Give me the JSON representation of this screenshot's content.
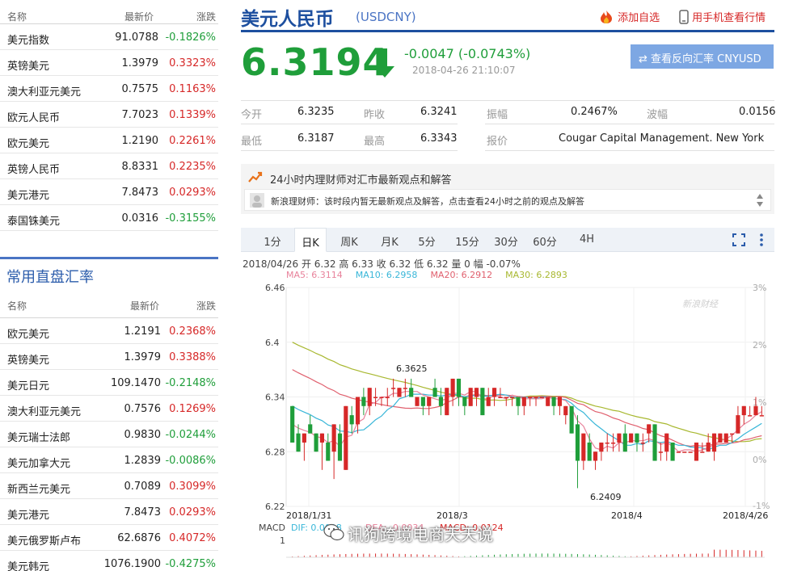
{
  "watchlist": {
    "headers": {
      "name": "名称",
      "price": "最新价",
      "change": "涨跌"
    },
    "rows": [
      {
        "name": "美元指数",
        "price": "91.0788",
        "change": "-0.1826%",
        "dir": "down"
      },
      {
        "name": "英镑美元",
        "price": "1.3979",
        "change": "0.3323%",
        "dir": "up"
      },
      {
        "name": "澳大利亚元美元",
        "price": "0.7575",
        "change": "0.1163%",
        "dir": "up"
      },
      {
        "name": "欧元人民币",
        "price": "7.7023",
        "change": "0.1339%",
        "dir": "up"
      },
      {
        "name": "欧元美元",
        "price": "1.2190",
        "change": "0.2261%",
        "dir": "up"
      },
      {
        "name": "英镑人民币",
        "price": "8.8331",
        "change": "0.2235%",
        "dir": "up"
      },
      {
        "name": "美元港元",
        "price": "7.8473",
        "change": "0.0293%",
        "dir": "up"
      },
      {
        "name": "泰国铢美元",
        "price": "0.0316",
        "change": "-0.3155%",
        "dir": "down"
      }
    ]
  },
  "direct_rates": {
    "title": "常用直盘汇率",
    "headers": {
      "name": "名称",
      "price": "最新价",
      "change": "涨跌"
    },
    "rows": [
      {
        "name": "欧元美元",
        "price": "1.2191",
        "change": "0.2368%",
        "dir": "up"
      },
      {
        "name": "英镑美元",
        "price": "1.3979",
        "change": "0.3388%",
        "dir": "up"
      },
      {
        "name": "美元日元",
        "price": "109.1470",
        "change": "-0.2148%",
        "dir": "down"
      },
      {
        "name": "澳大利亚元美元",
        "price": "0.7576",
        "change": "0.1269%",
        "dir": "up"
      },
      {
        "name": "美元瑞士法郎",
        "price": "0.9830",
        "change": "-0.0244%",
        "dir": "down"
      },
      {
        "name": "美元加拿大元",
        "price": "1.2839",
        "change": "-0.0086%",
        "dir": "down"
      },
      {
        "name": "新西兰元美元",
        "price": "0.7089",
        "change": "0.3099%",
        "dir": "up"
      },
      {
        "name": "美元港元",
        "price": "7.8473",
        "change": "0.0293%",
        "dir": "up"
      },
      {
        "name": "美元俄罗斯卢布",
        "price": "62.6876",
        "change": "0.4072%",
        "dir": "up"
      },
      {
        "name": "美元韩元",
        "price": "1076.1900",
        "change": "-0.4275%",
        "dir": "down"
      }
    ]
  },
  "quote": {
    "title": "美元人民币",
    "code": "(USDCNY)",
    "add_watch": "添加自选",
    "mobile_view": "用手机查看行情",
    "price": "6.3194",
    "change": "-0.0047 (-0.0743%)",
    "timestamp": "2018-04-26 21:10:07",
    "reverse_button": "查看反向汇率 CNYUSD",
    "stats": {
      "open_label": "今开",
      "open": "6.3235",
      "prev_close_label": "昨收",
      "prev_close": "6.3241",
      "amplitude_label": "振幅",
      "amplitude": "0.2467%",
      "wave_label": "波幅",
      "wave": "0.0156",
      "low_label": "最低",
      "low": "6.3187",
      "high_label": "最高",
      "high": "6.3343",
      "quote_label": "报价",
      "quote_source": "Cougar Capital Management. New York"
    }
  },
  "advice": {
    "title": "24小时内理财师对汇市最新观点和解答",
    "message": "新浪理财师：该时段内暂无最新观点及解答，点击查看24小时之前的观点及解答"
  },
  "chart_tabs": [
    "1分",
    "日K",
    "周K",
    "月K",
    "5分",
    "15分",
    "30分",
    "60分",
    "4H"
  ],
  "chart_active_tab": "日K",
  "ohlc_info": "2018/04/26  开 6.32  高 6.33  收 6.32  低 6.32  量 0  幅 -0.07%",
  "ma_legend": [
    {
      "text": "MA5: 6.3114",
      "color": "#e8829b"
    },
    {
      "text": "MA10: 6.2958",
      "color": "#38b6d8"
    },
    {
      "text": "MA20: 6.2912",
      "color": "#e0606e"
    },
    {
      "text": "MA30: 6.2893",
      "color": "#a8b830"
    }
  ],
  "macd_info": {
    "label": "MACD",
    "dif": "DIF: 0.0028",
    "dea": "DEA: -0.0034",
    "macd": "MACD: 0.0124",
    "axis_1": "1"
  },
  "watermark": "讯狗跨境电商天天说",
  "chart_logo": "新浪财经",
  "chart_data": {
    "type": "candlestick",
    "y_ticks": [
      "6.46",
      "6.4",
      "6.34",
      "6.28",
      "6.22"
    ],
    "y_range": [
      6.22,
      6.46
    ],
    "right_ticks": [
      "3%",
      "2%",
      "1%",
      "0%",
      "-1%"
    ],
    "x_labels": [
      "2018/1/31",
      "2018/3",
      "2018/4",
      "2018/4/26"
    ],
    "annotations": [
      {
        "text": "6.3625"
      },
      {
        "text": "6.2409"
      }
    ],
    "colors": {
      "up": "#d62828",
      "down": "#1f9e3a"
    },
    "candles": [
      [
        6.33,
        6.33,
        6.29,
        6.29
      ],
      [
        6.3,
        6.31,
        6.28,
        6.28
      ],
      [
        6.29,
        6.3,
        6.27,
        6.3
      ],
      [
        6.31,
        6.32,
        6.3,
        6.3
      ],
      [
        6.3,
        6.3,
        6.28,
        6.28
      ],
      [
        6.29,
        6.3,
        6.26,
        6.3
      ],
      [
        6.29,
        6.3,
        6.27,
        6.27
      ],
      [
        6.28,
        6.31,
        6.25,
        6.31
      ],
      [
        6.3,
        6.31,
        6.27,
        6.27
      ],
      [
        6.26,
        6.33,
        6.26,
        6.33
      ],
      [
        6.32,
        6.33,
        6.3,
        6.31
      ],
      [
        6.31,
        6.34,
        6.3,
        6.34
      ],
      [
        6.34,
        6.35,
        6.32,
        6.33
      ],
      [
        6.33,
        6.35,
        6.32,
        6.35
      ],
      [
        6.34,
        6.35,
        6.33,
        6.34
      ],
      [
        6.34,
        6.34,
        6.33,
        6.34
      ],
      [
        6.34,
        6.35,
        6.33,
        6.34
      ],
      [
        6.35,
        6.36,
        6.34,
        6.35
      ],
      [
        6.34,
        6.35,
        6.34,
        6.35
      ],
      [
        6.35,
        6.36,
        6.34,
        6.35
      ],
      [
        6.35,
        6.36,
        6.34,
        6.34
      ],
      [
        6.33,
        6.34,
        6.33,
        6.34
      ],
      [
        6.34,
        6.34,
        6.32,
        6.33
      ],
      [
        6.33,
        6.34,
        6.32,
        6.34
      ],
      [
        6.35,
        6.36,
        6.34,
        6.34
      ],
      [
        6.34,
        6.35,
        6.32,
        6.33
      ],
      [
        6.32,
        6.35,
        6.32,
        6.35
      ],
      [
        6.34,
        6.36,
        6.33,
        6.36
      ],
      [
        6.36,
        6.36,
        6.33,
        6.34
      ],
      [
        6.34,
        6.34,
        6.32,
        6.33
      ],
      [
        6.33,
        6.35,
        6.33,
        6.35
      ],
      [
        6.34,
        6.35,
        6.33,
        6.35
      ],
      [
        6.35,
        6.35,
        6.32,
        6.32
      ],
      [
        6.33,
        6.35,
        6.33,
        6.34
      ],
      [
        6.34,
        6.35,
        6.33,
        6.35
      ],
      [
        6.34,
        6.35,
        6.34,
        6.34
      ],
      [
        6.34,
        6.34,
        6.33,
        6.34
      ],
      [
        6.34,
        6.34,
        6.33,
        6.34
      ],
      [
        6.34,
        6.34,
        6.32,
        6.33
      ],
      [
        6.33,
        6.34,
        6.32,
        6.34
      ],
      [
        6.34,
        6.34,
        6.33,
        6.34
      ],
      [
        6.34,
        6.34,
        6.33,
        6.34
      ],
      [
        6.34,
        6.34,
        6.34,
        6.34
      ],
      [
        6.33,
        6.34,
        6.33,
        6.34
      ],
      [
        6.34,
        6.34,
        6.32,
        6.33
      ],
      [
        6.33,
        6.34,
        6.32,
        6.34
      ],
      [
        6.32,
        6.33,
        6.31,
        6.33
      ],
      [
        6.33,
        6.33,
        6.3,
        6.3
      ],
      [
        6.31,
        6.32,
        6.24,
        6.27
      ],
      [
        6.27,
        6.3,
        6.26,
        6.3
      ],
      [
        6.29,
        6.3,
        6.27,
        6.27
      ],
      [
        6.27,
        6.28,
        6.26,
        6.28
      ],
      [
        6.28,
        6.29,
        6.27,
        6.29
      ],
      [
        6.29,
        6.3,
        6.28,
        6.29
      ],
      [
        6.29,
        6.3,
        6.28,
        6.29
      ],
      [
        6.29,
        6.3,
        6.28,
        6.3
      ],
      [
        6.3,
        6.31,
        6.28,
        6.28
      ],
      [
        6.29,
        6.3,
        6.29,
        6.3
      ],
      [
        6.3,
        6.3,
        6.28,
        6.29
      ],
      [
        6.29,
        6.3,
        6.28,
        6.29
      ],
      [
        6.3,
        6.31,
        6.29,
        6.31
      ],
      [
        6.31,
        6.31,
        6.27,
        6.27
      ],
      [
        6.28,
        6.29,
        6.27,
        6.28
      ],
      [
        6.28,
        6.3,
        6.27,
        6.3
      ],
      [
        6.29,
        6.29,
        6.27,
        6.27
      ],
      [
        6.28,
        6.28,
        6.28,
        6.28
      ],
      [
        6.28,
        6.28,
        6.28,
        6.28
      ],
      [
        6.28,
        6.28,
        6.28,
        6.28
      ],
      [
        6.27,
        6.29,
        6.27,
        6.29
      ],
      [
        6.28,
        6.29,
        6.28,
        6.28
      ],
      [
        6.28,
        6.3,
        6.28,
        6.29
      ],
      [
        6.28,
        6.3,
        6.27,
        6.3
      ],
      [
        6.29,
        6.3,
        6.29,
        6.3
      ],
      [
        6.29,
        6.3,
        6.29,
        6.3
      ],
      [
        6.3,
        6.3,
        6.29,
        6.3
      ],
      [
        6.3,
        6.33,
        6.3,
        6.32
      ],
      [
        6.32,
        6.33,
        6.31,
        6.33
      ],
      [
        6.32,
        6.33,
        6.32,
        6.32
      ],
      [
        6.32,
        6.34,
        6.32,
        6.33
      ],
      [
        6.32,
        6.33,
        6.32,
        6.32
      ]
    ]
  }
}
